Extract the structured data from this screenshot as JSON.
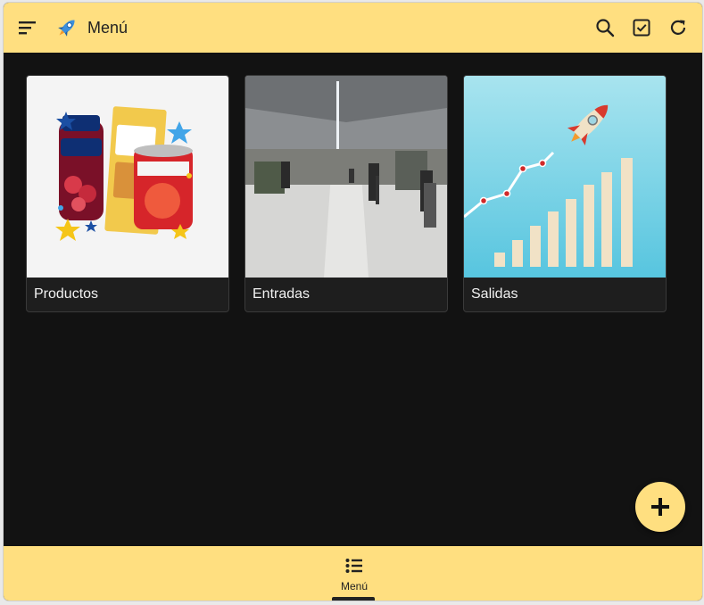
{
  "header": {
    "title": "Menú",
    "menu_icon": "sort-menu-icon",
    "logo_icon": "rocket-icon",
    "actions": [
      "search-icon",
      "checkbox-icon",
      "refresh-icon"
    ]
  },
  "cards": [
    {
      "label": "Productos",
      "image": "grocery-products-image"
    },
    {
      "label": "Entradas",
      "image": "warehouse-image"
    },
    {
      "label": "Salidas",
      "image": "growth-chart-rocket-image"
    }
  ],
  "fab": {
    "icon": "plus-icon"
  },
  "bottom_nav": {
    "items": [
      {
        "label": "Menú",
        "icon": "list-icon",
        "active": true
      }
    ]
  },
  "colors": {
    "accent": "#ffdf80",
    "background": "#121212",
    "card": "#1e1e1e"
  }
}
